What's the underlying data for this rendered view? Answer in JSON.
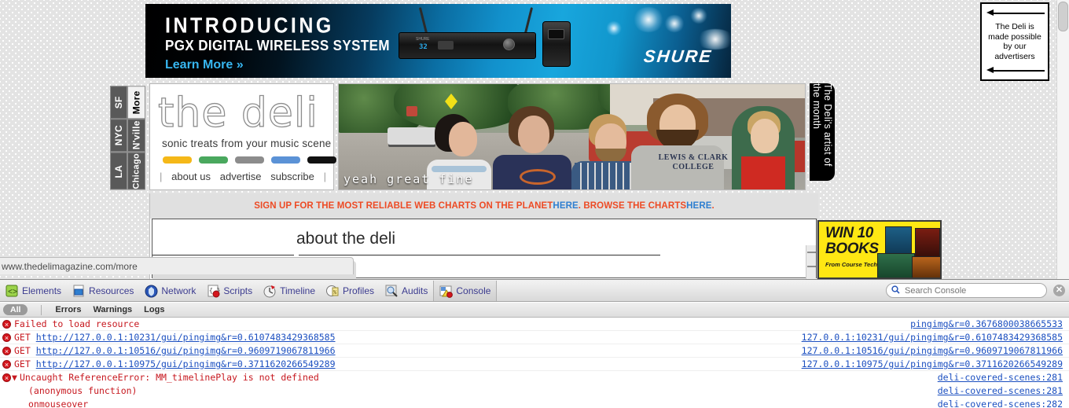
{
  "ads": {
    "shure": {
      "headline": "INTRODUCING",
      "subhead": "PGX DIGITAL WIRELESS SYSTEM",
      "cta": "Learn More »",
      "brand": "SHURE",
      "display_value": "32"
    },
    "advertisers_note": "The Deli is made possible by our advertisers",
    "books": {
      "title_line1": "WIN 10",
      "title_line2": "BOOKS",
      "subtitle": "From Course Technology PTR!"
    }
  },
  "site": {
    "city_tabs": [
      {
        "label": "SF",
        "selected": false
      },
      {
        "label": "More",
        "selected": true
      },
      {
        "label": "NYC",
        "selected": false
      },
      {
        "label": "N'ville",
        "selected": false
      },
      {
        "label": "LA",
        "selected": false
      },
      {
        "label": "Chicago",
        "selected": false
      }
    ],
    "logo_word": "the deli",
    "tagline": "sonic treats from your music scene",
    "swatch_colors": [
      "#f5b818",
      "#4aa85e",
      "#8c8c8c",
      "#5b92d6",
      "#111111"
    ],
    "nav": [
      {
        "label": "about us"
      },
      {
        "label": "advertise"
      },
      {
        "label": "subscribe"
      }
    ],
    "photo_caption": "yeah great fine",
    "shirt_text": "LEWIS & CLARK COLLEGE",
    "artist_tab": "The Deli's artist of the month"
  },
  "content": {
    "signup_pre": "SIGN UP FOR THE MOST RELIABLE WEB CHARTS ON THE PLANET ",
    "signup_link1": "HERE",
    "signup_mid": ". BROWSE THE CHARTS ",
    "signup_link2": "HERE",
    "signup_end": ".",
    "page_title": "about the deli"
  },
  "status_bar": {
    "url": "www.thedelimagazine.com/more"
  },
  "devtools": {
    "tabs": [
      {
        "label": "Elements",
        "icon": "elements-icon",
        "active": false
      },
      {
        "label": "Resources",
        "icon": "resources-icon",
        "active": false
      },
      {
        "label": "Network",
        "icon": "network-icon",
        "active": false
      },
      {
        "label": "Scripts",
        "icon": "scripts-icon",
        "active": false
      },
      {
        "label": "Timeline",
        "icon": "timeline-icon",
        "active": false
      },
      {
        "label": "Profiles",
        "icon": "profiles-icon",
        "active": false
      },
      {
        "label": "Audits",
        "icon": "audits-icon",
        "active": false
      },
      {
        "label": "Console",
        "icon": "console-icon",
        "active": true
      }
    ],
    "search_placeholder": "Search Console",
    "close_label": "✕",
    "filters": {
      "all": "All",
      "errors": "Errors",
      "warnings": "Warnings",
      "logs": "Logs"
    },
    "console_rows": [
      {
        "type": "error",
        "method": "",
        "text": "Failed to load resource",
        "link": "",
        "source": "pingimg&r=0.3676800038665533"
      },
      {
        "type": "error",
        "method": "GET",
        "text": "",
        "link": "http://127.0.0.1:10231/gui/pingimg&r=0.6107483429368585",
        "source": "127.0.0.1:10231/gui/pingimg&r=0.6107483429368585"
      },
      {
        "type": "error",
        "method": "GET",
        "text": "",
        "link": "http://127.0.0.1:10516/gui/pingimg&r=0.9609719067811966",
        "source": "127.0.0.1:10516/gui/pingimg&r=0.9609719067811966"
      },
      {
        "type": "error",
        "method": "GET",
        "text": "",
        "link": "http://127.0.0.1:10975/gui/pingimg&r=0.3711620266549289",
        "source": "127.0.0.1:10975/gui/pingimg&r=0.3711620266549289"
      },
      {
        "type": "error-expandable",
        "method": "",
        "text": "Uncaught ReferenceError: MM_timelinePlay is not defined",
        "link": "",
        "source": "deli-covered-scenes:281"
      },
      {
        "type": "stack",
        "method": "",
        "text": "(anonymous function)",
        "link": "",
        "source": "deli-covered-scenes:281"
      },
      {
        "type": "stack",
        "method": "",
        "text": "onmouseover",
        "link": "",
        "source": "deli-covered-scenes:282"
      }
    ]
  },
  "colors": {
    "error_red": "#c7181f",
    "link_blue": "#1b4fc0",
    "signup_orange": "#ed4a24",
    "signup_link_blue": "#2f7fd0",
    "books_yellow": "#ffe713",
    "tab_text_blue": "#3b3b8f"
  }
}
